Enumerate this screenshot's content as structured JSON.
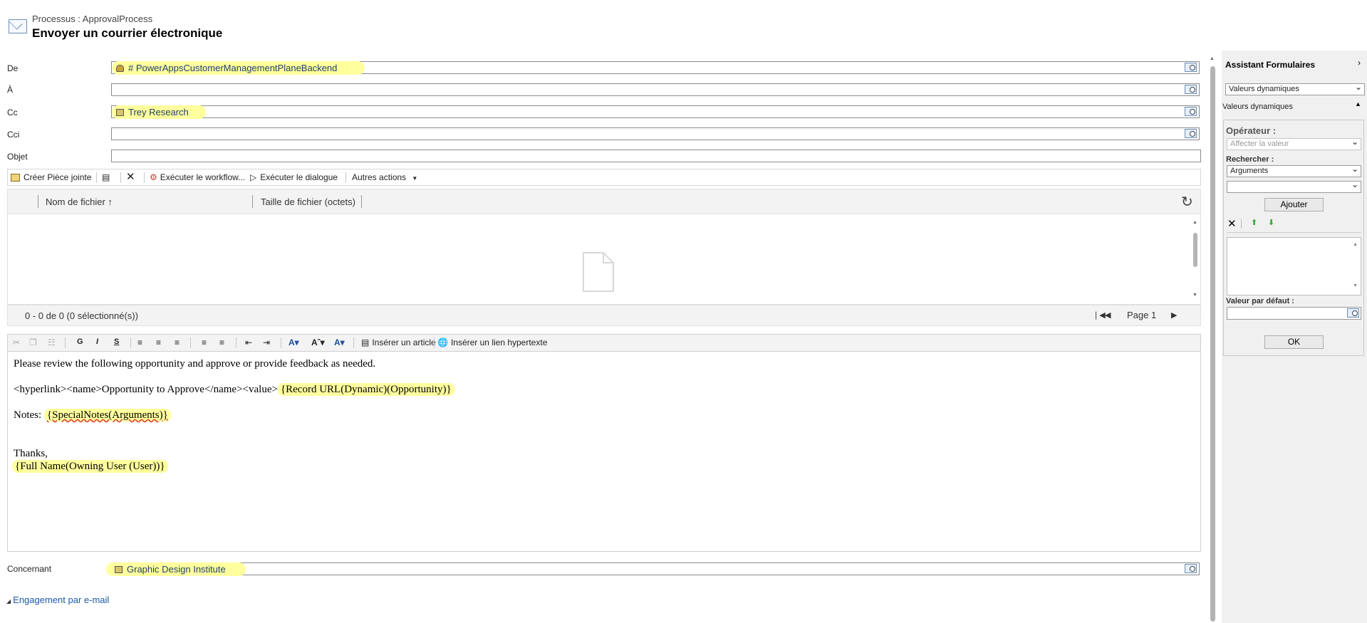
{
  "header": {
    "process": "Processus : ApprovalProcess",
    "title": "Envoyer un courrier électronique"
  },
  "form": {
    "from_label": "De",
    "from_value": "# PowerAppsCustomerManagementPlaneBackend",
    "to_label": "À",
    "cc_label": "Cc",
    "cc_value": "Trey Research",
    "bcc_label": "Cci",
    "subject_label": "Objet",
    "regarding_label": "Concernant",
    "regarding_value": "Graphic Design Institute"
  },
  "toolbar": {
    "create_attachment": "Créer Pièce jointe",
    "run_workflow": "Exécuter le workflow...",
    "run_dialog": "Exécuter le dialogue",
    "other_actions": "Autres actions"
  },
  "grid": {
    "col_filename": "Nom de fichier ↑",
    "col_filesize": "Taille de fichier (octets)",
    "status": "0 - 0  de 0 (0 sélectionné(s))",
    "page": "Page 1"
  },
  "editor_toolbar": {
    "bold": "G",
    "italic": "I",
    "strike": "S",
    "insert_article": "Insérer un article",
    "insert_link": "Insérer un lien hypertexte"
  },
  "body": {
    "line1": "Please review the following opportunity and approve or provide feedback as needed.",
    "line2_prefix": "<hyperlink><name>Opportunity to Approve</name><value>",
    "line2_dynamic": "{Record URL(Dynamic)(Opportunity)}",
    "line3_prefix": "Notes: ",
    "line3_dynamic": "{SpecialNotes(Arguments)}",
    "line4": "Thanks,",
    "line5_dynamic": "{Full Name(Owning User (User))}"
  },
  "section_link": "Engagement par e-mail",
  "assistant": {
    "title": "Assistant Formulaires",
    "top_select": "Valeurs dynamiques",
    "section": "Valeurs dynamiques",
    "operator_label": "Opérateur :",
    "operator_value": "Affecter la valeur",
    "search_label": "Rechercher :",
    "search_value": "Arguments",
    "second_value": "",
    "add_button": "Ajouter",
    "default_label": "Valeur par défaut :",
    "ok_button": "OK"
  },
  "colors": {
    "highlight": "#ffff9e",
    "link": "#1a5aa6",
    "lookup_text": "#1f3f6b"
  }
}
